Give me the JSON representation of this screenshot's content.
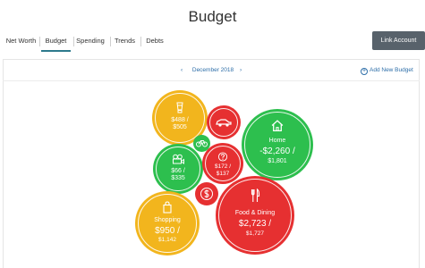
{
  "page": {
    "title": "Budget"
  },
  "tabs": [
    {
      "label": "Net Worth"
    },
    {
      "label": "Budget"
    },
    {
      "label": "Spending"
    },
    {
      "label": "Trends"
    },
    {
      "label": "Debts"
    }
  ],
  "link_account": {
    "label": "Link Account"
  },
  "month_nav": {
    "prev": "‹",
    "label": "December 2018",
    "next": "›"
  },
  "add_budget": {
    "label": "Add New Budget"
  },
  "colors": {
    "over": "#e63031",
    "near": "#f2b51d",
    "under": "#2dbf4e",
    "accent": "#2d7a8c"
  },
  "bubbles": {
    "drinks": {
      "icon": "cup-icon",
      "line1": "$488 /",
      "line2": "$505"
    },
    "auto": {
      "icon": "car-icon"
    },
    "home": {
      "icon": "house-icon",
      "name": "Home",
      "line1": "-$2,260 /",
      "line2": "$1,801"
    },
    "bike": {
      "icon": "bicycle-icon"
    },
    "entertainment": {
      "icon": "camera-icon",
      "line1": "$66 /",
      "line2": "$335"
    },
    "misc": {
      "icon": "question-icon",
      "line1": "$172 /",
      "line2": "$137"
    },
    "fees": {
      "icon": "dollar-icon"
    },
    "shopping": {
      "icon": "bag-icon",
      "name": "Shopping",
      "line1": "$950 /",
      "line2": "$1,142"
    },
    "food": {
      "icon": "utensils-icon",
      "name": "Food & Dining",
      "line1": "$2,723 /",
      "line2": "$1,727"
    }
  }
}
